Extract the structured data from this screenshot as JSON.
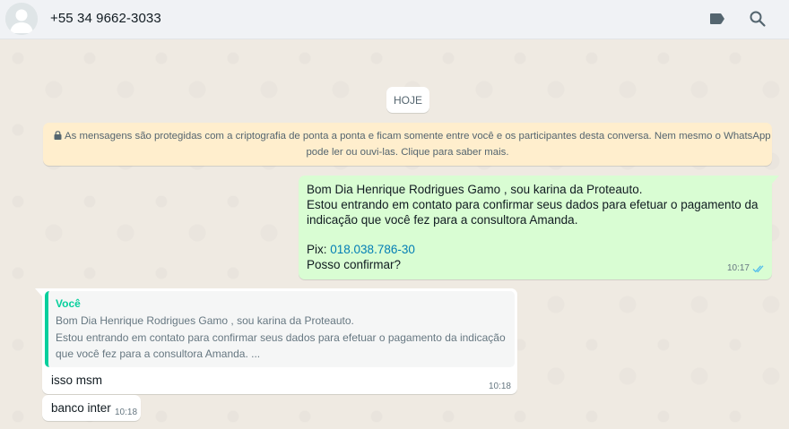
{
  "header": {
    "contact_name": "+55 34 9662-3033",
    "icons": [
      "avatar-placeholder",
      "label-icon",
      "search-icon"
    ]
  },
  "chat": {
    "day_label": "HOJE",
    "encryption_notice": {
      "line1": "As mensagens são protegidas com a criptografia de ponta a ponta e ficam somente entre você e os participantes desta conversa. Nem mesmo o WhatsApp",
      "line2": "pode ler ou ouvi-las. Clique para saber mais."
    },
    "outgoing": {
      "line1": "Bom Dia Henrique Rodrigues Gamo  , sou karina da Proteauto.",
      "line2": "Estou entrando em contato para confirmar seus dados para efetuar o pagamento da",
      "line3": "indicação que você fez para a consultora Amanda.",
      "pix_label": "Pix: ",
      "pix_value": "018.038.786-30",
      "line5": "Posso confirmar?",
      "time": "10:17",
      "status": "read"
    },
    "incoming_reply": {
      "quote_author": "Você",
      "quote_line1": "Bom Dia Henrique Rodrigues Gamo  , sou karina da Proteauto.",
      "quote_line2": "Estou entrando em contato para confirmar seus dados para efetuar o pagamento da indicação",
      "quote_line3": "que você fez para a consultora Amanda. ...",
      "text": "isso msm",
      "time": "10:18"
    },
    "incoming_small": {
      "text": "banco inter",
      "time": "10:18"
    }
  },
  "colors": {
    "header_bg": "#f0f2f5",
    "chat_bg": "#efeae2",
    "outgoing_bubble": "#d9fdd3",
    "notice_bg": "#ffeecd",
    "quote_accent": "#06cf9c",
    "link": "#027eb5",
    "read_ticks": "#53bdeb"
  }
}
